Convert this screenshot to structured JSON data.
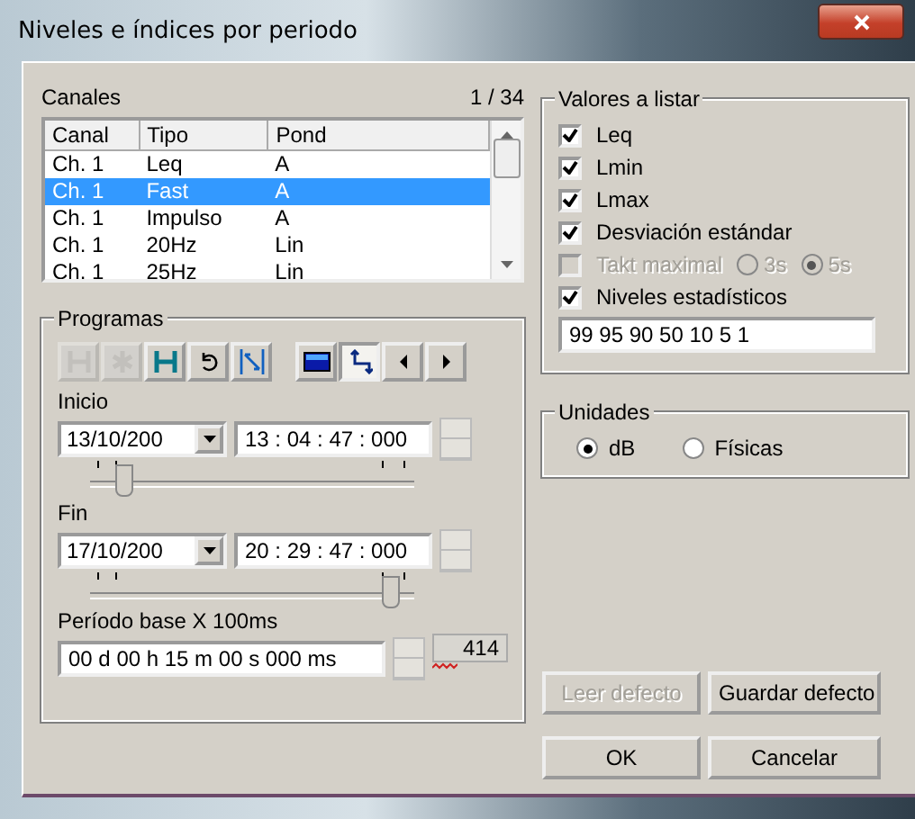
{
  "window": {
    "title": "Niveles e índices por periodo"
  },
  "channels": {
    "label": "Canales",
    "counter": "1 / 34",
    "columns": [
      "Canal",
      "Tipo",
      "Pond"
    ],
    "rows": [
      {
        "cells": [
          "Ch. 1",
          "Leq",
          "A"
        ],
        "selected": false
      },
      {
        "cells": [
          "Ch. 1",
          "Fast",
          "A"
        ],
        "selected": true
      },
      {
        "cells": [
          "Ch. 1",
          "Impulso",
          "A"
        ],
        "selected": false
      },
      {
        "cells": [
          "Ch. 1",
          "20Hz",
          "Lin"
        ],
        "selected": false
      },
      {
        "cells": [
          "Ch. 1",
          "25Hz",
          "Lin"
        ],
        "selected": false
      }
    ]
  },
  "programs": {
    "label": "Programas",
    "tools": [
      {
        "kind": "bracket",
        "disabled": true,
        "pressed": false
      },
      {
        "kind": "asterisk",
        "disabled": true,
        "pressed": false
      },
      {
        "kind": "bracket",
        "disabled": false,
        "pressed": false
      },
      {
        "kind": "undo",
        "disabled": false,
        "pressed": false
      },
      {
        "kind": "fit",
        "disabled": false,
        "pressed": false
      },
      {
        "kind": "window",
        "disabled": false,
        "pressed": false
      },
      {
        "kind": "axes",
        "disabled": false,
        "pressed": true
      },
      {
        "kind": "left",
        "disabled": false,
        "pressed": false
      },
      {
        "kind": "right",
        "disabled": false,
        "pressed": false
      }
    ],
    "start": {
      "label": "Inicio",
      "date": "13/10/200",
      "time": "13 : 04 : 47 : 000",
      "level": 0.1
    },
    "end": {
      "label": "Fin",
      "date": "17/10/200",
      "time": "20 : 29 : 47 : 000",
      "level": 0.92
    },
    "period": {
      "label": "Período base X 100ms",
      "value": "00 d 00 h 15 m 00 s 000 ms",
      "count": "414"
    }
  },
  "values": {
    "label": "Valores a listar",
    "items": [
      {
        "label": "Leq",
        "checked": true,
        "disabled": false
      },
      {
        "label": "Lmin",
        "checked": true,
        "disabled": false
      },
      {
        "label": "Lmax",
        "checked": true,
        "disabled": false
      },
      {
        "label": "Desviación estándar",
        "checked": true,
        "disabled": false
      },
      {
        "label": "Takt maximal",
        "checked": false,
        "disabled": true,
        "options": [
          {
            "label": "3s",
            "selected": false
          },
          {
            "label": "5s",
            "selected": true
          }
        ]
      },
      {
        "label": "Niveles estadísticos",
        "checked": true,
        "disabled": false
      }
    ],
    "percentiles": "99 95 90 50 10 5 1"
  },
  "units": {
    "label": "Unidades",
    "options": [
      {
        "label": "dB",
        "selected": true
      },
      {
        "label": "Físicas",
        "selected": false
      }
    ]
  },
  "buttons": [
    {
      "label": "Leer defecto",
      "disabled": true
    },
    {
      "label": "Guardar defecto",
      "disabled": false
    },
    {
      "label": "OK",
      "disabled": false
    },
    {
      "label": "Cancelar",
      "disabled": false
    }
  ]
}
